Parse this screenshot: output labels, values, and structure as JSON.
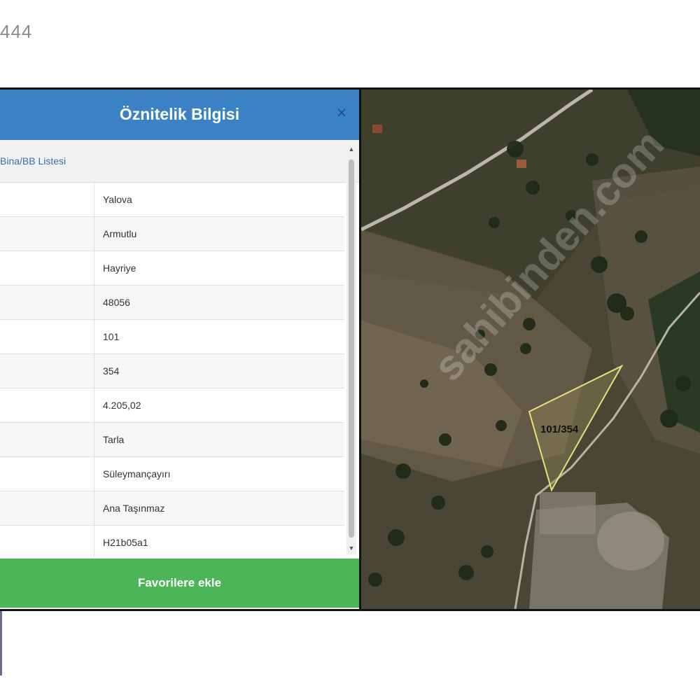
{
  "listing_id": "444",
  "panel": {
    "title": "Öznitelik Bilgisi",
    "close_label": "×",
    "tab_label": "Bina/BB Listesi",
    "rows": [
      "Yalova",
      "Armutlu",
      "Hayriye",
      "48056",
      "101",
      "354",
      "4.205,02",
      "Tarla",
      "Süleymançayırı",
      "Ana Taşınmaz",
      "H21b05a1"
    ],
    "favorite_button": "Favorilere ekle"
  },
  "map": {
    "parcel_label": "101/354",
    "watermark": "sahibinden.com"
  },
  "colors": {
    "header": "#3b82c4",
    "button": "#4cb558",
    "parcel_outline": "#e3e37a"
  }
}
